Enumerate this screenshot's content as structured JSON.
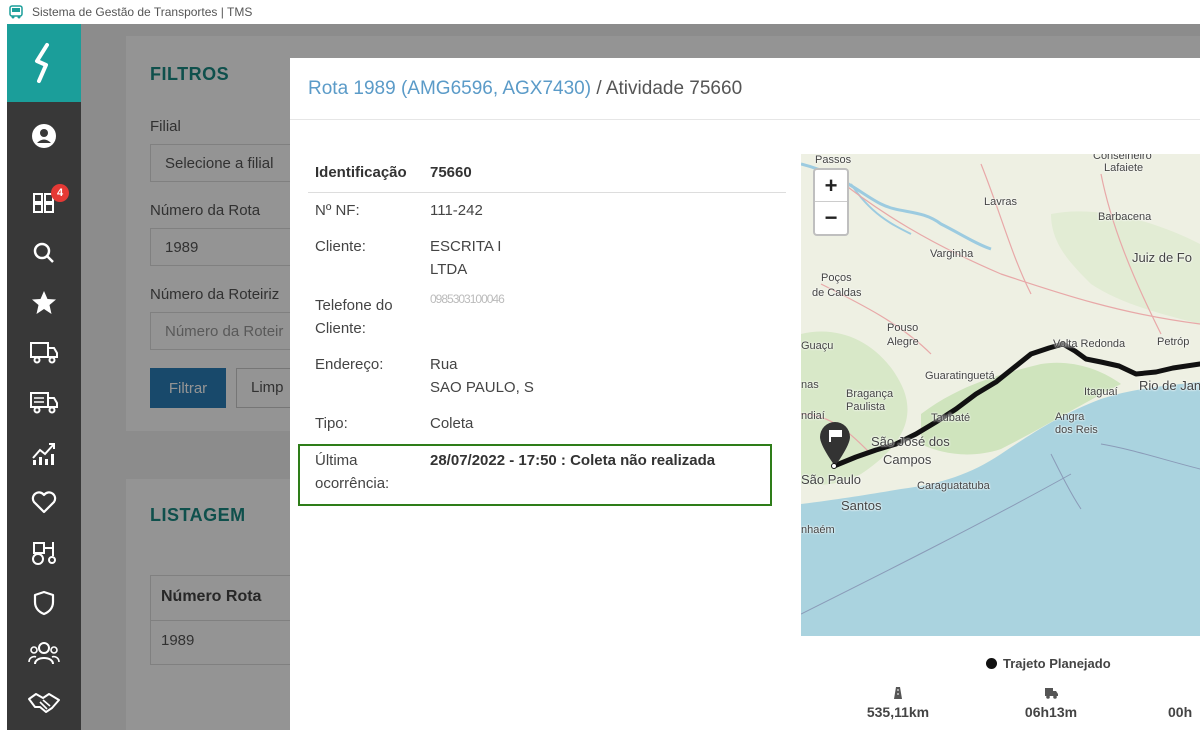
{
  "window": {
    "title": "Sistema de Gestão de Transportes | TMS"
  },
  "sidebar": {
    "badge_count": "4",
    "icons": [
      "user-icon",
      "dashboard-icon",
      "search-icon",
      "star-icon",
      "truck-icon",
      "truck-list-icon",
      "chart-icon",
      "heart-icon",
      "tractor-icon",
      "shield-icon",
      "team-icon",
      "handshake-icon"
    ]
  },
  "filters": {
    "title": "FILTROS",
    "filial_label": "Filial",
    "filial_value": "Selecione a filial",
    "rota_label": "Número da Rota",
    "rota_value": "1989",
    "roteirizacao_label": "Número da Roteiriz",
    "roteirizacao_placeholder": "Número da Roteir",
    "filtrar_label": "Filtrar",
    "limpar_label": "Limp"
  },
  "listagem": {
    "title": "LISTAGEM",
    "column_header": "Número Rota",
    "row_value": "1989"
  },
  "modal": {
    "title_route": "Rota 1989 (AMG6596, AGX7430)",
    "title_sep": " / ",
    "title_activity": "Atividade 75660",
    "fields": {
      "identificacao_label": "Identificação",
      "identificacao_value": "75660",
      "nf_label": "Nº NF:",
      "nf_value": "111-242",
      "cliente_label": "Cliente:",
      "cliente_value_1": "ESCRITA I",
      "cliente_value_2": "LTDA",
      "telefone_label_1": "Telefone do",
      "telefone_label_2": "Cliente:",
      "telefone_value": "0985303100046",
      "endereco_label": "Endereço:",
      "endereco_value_1": "Rua",
      "endereco_value_2": "SAO PAULO, S",
      "tipo_label": "Tipo:",
      "tipo_value": "Coleta",
      "ocorrencia_label_1": "Última",
      "ocorrencia_label_2": "ocorrência:",
      "ocorrencia_value": "28/07/2022 - 17:50 : Coleta não realizada"
    }
  },
  "map": {
    "zoom_in": "+",
    "zoom_out": "−",
    "places": [
      {
        "name": "Passos"
      },
      {
        "name": "Conselheiro"
      },
      {
        "name": "Lafaiete"
      },
      {
        "name": "Lavras"
      },
      {
        "name": "Barbacena"
      },
      {
        "name": "Varginha"
      },
      {
        "name": "Juiz de Fo"
      },
      {
        "name": "Poços"
      },
      {
        "name": "de Caldas"
      },
      {
        "name": "Pouso"
      },
      {
        "name": "Alegre"
      },
      {
        "name": "Guaçu"
      },
      {
        "name": "Volta Redonda"
      },
      {
        "name": "Petróp"
      },
      {
        "name": "Guaratinguetá"
      },
      {
        "name": "nas"
      },
      {
        "name": "Bragança"
      },
      {
        "name": "Paulista"
      },
      {
        "name": "Itaguaí"
      },
      {
        "name": "Rio de Jan"
      },
      {
        "name": "Taubaté"
      },
      {
        "name": "Angra"
      },
      {
        "name": "dos Reis"
      },
      {
        "name": "ndiaí"
      },
      {
        "name": "São José dos"
      },
      {
        "name": "Campos"
      },
      {
        "name": "São Paulo"
      },
      {
        "name": "Caraguatatuba"
      },
      {
        "name": "Santos"
      },
      {
        "name": "nhaém"
      }
    ],
    "legend_label": "Trajeto Planejado",
    "distance": "535,11km",
    "duration": "06h13m",
    "third_stat": "00h"
  }
}
